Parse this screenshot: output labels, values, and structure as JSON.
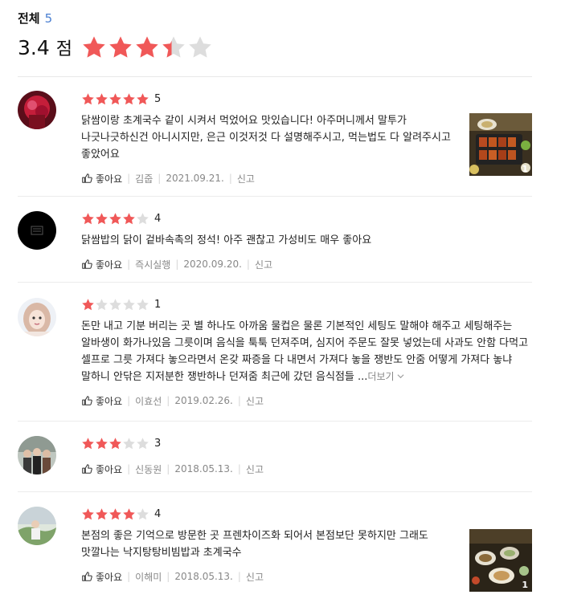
{
  "summary": {
    "label": "전체",
    "count": "5",
    "score": "3.4",
    "unit": "점",
    "stars": 3.4
  },
  "colors": {
    "star_on": "#f05858",
    "star_off": "#dddddd",
    "count_blue": "#4a7fd1"
  },
  "reviews": [
    {
      "rating": 5,
      "rating_text": "5",
      "text": "닭쌈이랑 초계국수 같이 시켜서 먹었어요 맛있습니다!  아주머니께서 말투가 나긋나긋하신건 아니시지만, 은근 이것저것 다 설명해주시고, 먹는법도 다 알려주시고 좋았어요",
      "more": "",
      "like_label": "좋아요",
      "author": "김줍",
      "date": "2021.09.21.",
      "report_label": "신고",
      "photo_count": "1",
      "avatar": "red-portrait"
    },
    {
      "rating": 4,
      "rating_text": "4",
      "text": "닭쌈밥의 닭이 겉바속촉의 정석! 아주 괜찮고 가성비도 매우 좋아요",
      "more": "",
      "like_label": "좋아요",
      "author": "즉시실행",
      "date": "2020.09.20.",
      "report_label": "신고",
      "photo_count": "",
      "avatar": "black-logo"
    },
    {
      "rating": 1,
      "rating_text": "1",
      "text": "돈만 내고 기분 버리는 곳 별 하나도 아까움 물컵은 물론 기본적인 세팅도 말해야 해주고 세팅해주는 알바생이 화가나있음 그릇이며 음식을 툭툭 던져주며, 심지어 주문도 잘못 넣었는데 사과도 안함 다먹고 셀프로 그릇 가져다 놓으라면서 온갖 짜증을 다 내면서 가져다 놓을 쟁반도 안줌 어떻게 가져다 놓냐 말하니 안닦은 지저분한 쟁반하나 던져줌 최근에 갔던 음식점들 ...",
      "more": "더보기",
      "like_label": "좋아요",
      "author": "이효선",
      "date": "2019.02.26.",
      "report_label": "신고",
      "photo_count": "",
      "avatar": "girl-portrait"
    },
    {
      "rating": 3,
      "rating_text": "3",
      "text": "",
      "more": "",
      "like_label": "좋아요",
      "author": "신동원",
      "date": "2018.05.13.",
      "report_label": "신고",
      "photo_count": "",
      "avatar": "group-photo"
    },
    {
      "rating": 4,
      "rating_text": "4",
      "text": "본점의 좋은 기억으로 방문한 곳 프렌차이즈화 되어서 본점보단 못하지만 그래도 맛깔나는 낙지탕탕비빔밥과 초계국수",
      "more": "",
      "like_label": "좋아요",
      "author": "이해미",
      "date": "2018.05.13.",
      "report_label": "신고",
      "photo_count": "1",
      "avatar": "outdoor-person"
    }
  ]
}
